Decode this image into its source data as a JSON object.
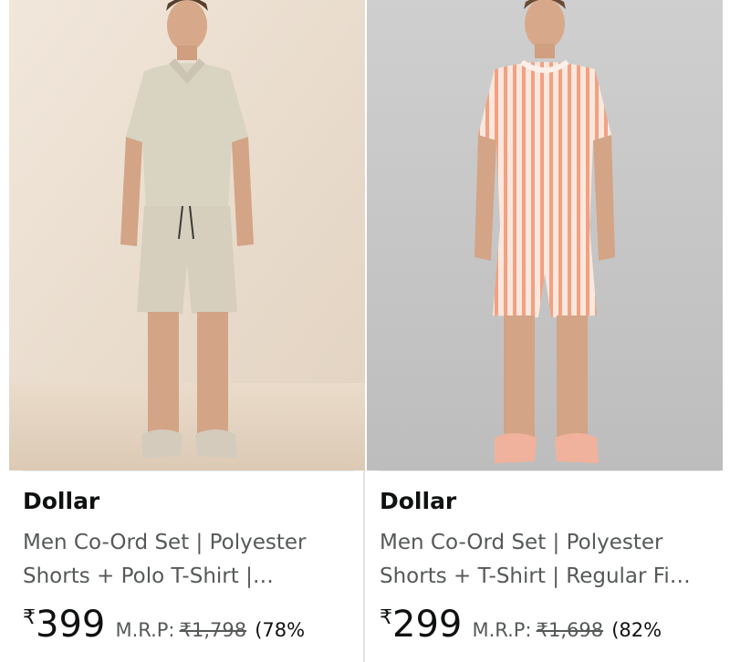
{
  "products": [
    {
      "brand": "Dollar",
      "title_line1": "Men Co-Ord Set | Polyester",
      "title_line2": "Shorts + Polo T-Shirt |…",
      "currency": "₹",
      "price": "399",
      "mrp_label": "M.R.P:",
      "mrp": "₹1,798",
      "discount": "(78%"
    },
    {
      "brand": "Dollar",
      "title_line1": "Men Co-Ord Set | Polyester",
      "title_line2": "Shorts + T-Shirt | Regular Fi…",
      "currency": "₹",
      "price": "299",
      "mrp_label": "M.R.P:",
      "mrp": "₹1,698",
      "discount": "(82%"
    }
  ],
  "colors": {
    "left_bg": "#e9dccd",
    "right_bg": "#c7c7c7",
    "polo": "#d9d3c2",
    "stripe_base": "#fbe7dc",
    "stripe": "#f2a182"
  }
}
